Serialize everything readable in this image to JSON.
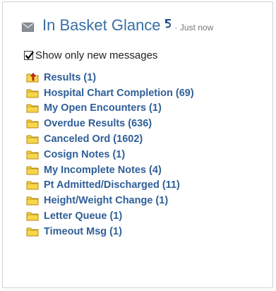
{
  "header": {
    "title": "In Basket Glance",
    "timestamp": "· Just now"
  },
  "filter": {
    "show_new_label": "Show only new messages",
    "checked": true
  },
  "items": [
    {
      "label": "Results (1)",
      "icon": "folder-alert-icon"
    },
    {
      "label": "Hospital Chart Completion (69)",
      "icon": "folder-icon"
    },
    {
      "label": "My Open Encounters (1)",
      "icon": "folder-icon"
    },
    {
      "label": "Overdue Results (636)",
      "icon": "folder-icon"
    },
    {
      "label": "Canceled Ord (1602)",
      "icon": "folder-icon"
    },
    {
      "label": "Cosign Notes (1)",
      "icon": "folder-icon"
    },
    {
      "label": "My Incomplete Notes (4)",
      "icon": "folder-icon"
    },
    {
      "label": "Pt Admitted/Discharged (11)",
      "icon": "folder-icon"
    },
    {
      "label": "Height/Weight Change (1)",
      "icon": "folder-icon"
    },
    {
      "label": "Letter Queue (1)",
      "icon": "folder-icon"
    },
    {
      "label": "Timeout Msg (1)",
      "icon": "folder-icon"
    }
  ],
  "colors": {
    "title": "#3a6ea5",
    "item_text": "#2f5f98",
    "folder_fill": "#f7d64a",
    "folder_stroke": "#b58a12",
    "alert_arrow": "#d02020"
  }
}
